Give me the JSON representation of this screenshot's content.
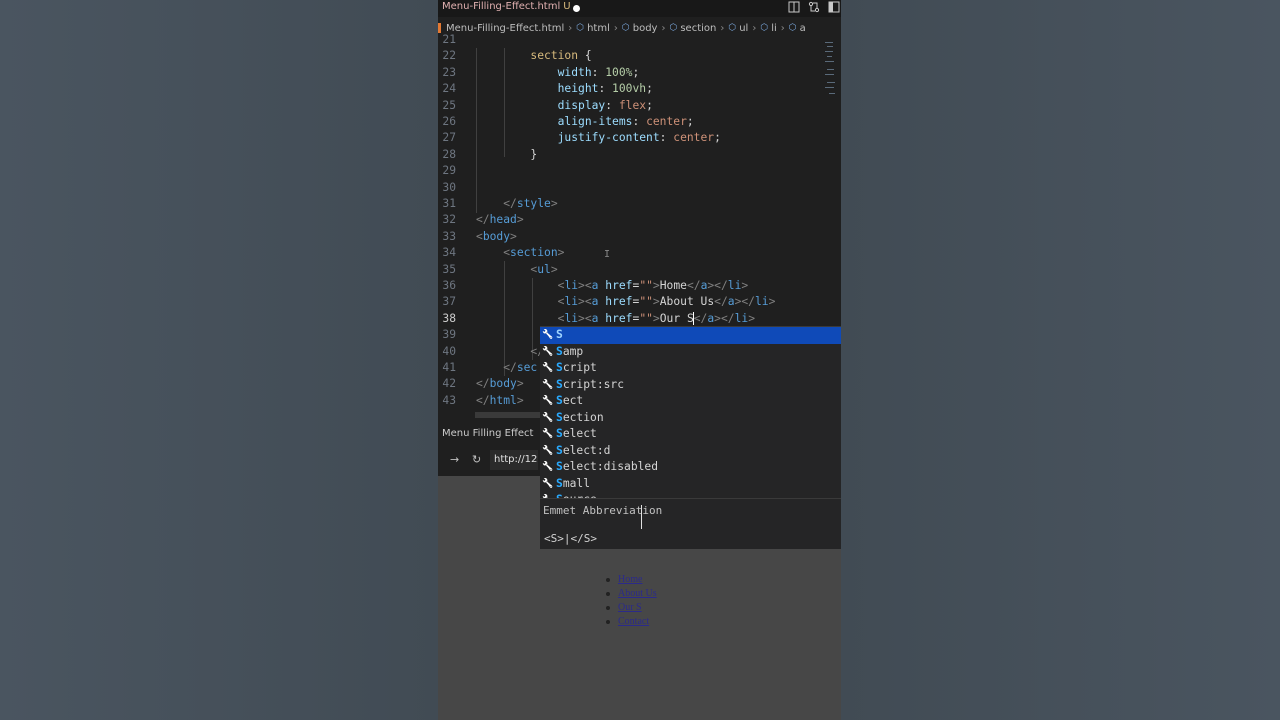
{
  "titlebar": {
    "file_tab": "Menu-Filling-Effect.html",
    "modified_flag": "U",
    "icons": [
      "split-editor-icon",
      "compare-icon",
      "layout-icon"
    ]
  },
  "breadcrumb": {
    "items": [
      "Menu-Filling-Effect.html",
      "html",
      "body",
      "section",
      "ul",
      "li",
      "a"
    ]
  },
  "editor": {
    "active_line": "38",
    "lines": [
      {
        "n": "21",
        "html": ""
      },
      {
        "n": "22",
        "html": "        <span class='sel'>section</span> {"
      },
      {
        "n": "23",
        "html": "            <span class='prop'>width</span>: <span class='num'>100%</span>;"
      },
      {
        "n": "24",
        "html": "            <span class='prop'>height</span>: <span class='num'>100vh</span>;"
      },
      {
        "n": "25",
        "html": "            <span class='prop'>display</span>: <span class='val'>flex</span>;"
      },
      {
        "n": "26",
        "html": "            <span class='prop'>align-items</span>: <span class='val'>center</span>;"
      },
      {
        "n": "27",
        "html": "            <span class='prop'>justify-content</span>: <span class='val'>center</span>;"
      },
      {
        "n": "28",
        "html": "        }"
      },
      {
        "n": "29",
        "html": ""
      },
      {
        "n": "30",
        "html": ""
      },
      {
        "n": "31",
        "html": "    <span class='br'>&lt;/</span><span class='tag'>style</span><span class='br'>&gt;</span>"
      },
      {
        "n": "32",
        "html": "<span class='br'>&lt;/</span><span class='tag'>head</span><span class='br'>&gt;</span>"
      },
      {
        "n": "33",
        "html": "<span class='br'>&lt;</span><span class='tag'>body</span><span class='br'>&gt;</span>"
      },
      {
        "n": "34",
        "html": "    <span class='br'>&lt;</span><span class='tag'>section</span><span class='br'>&gt;</span>"
      },
      {
        "n": "35",
        "html": "        <span class='br'>&lt;</span><span class='tag'>ul</span><span class='br'>&gt;</span>"
      },
      {
        "n": "36",
        "html": "            <span class='br'>&lt;</span><span class='tag'>li</span><span class='br'>&gt;&lt;</span><span class='tag'>a</span> <span class='attr'>href</span>=<span class='str'>\"\"</span><span class='br'>&gt;</span>Home<span class='br'>&lt;/</span><span class='tag'>a</span><span class='br'>&gt;&lt;/</span><span class='tag'>li</span><span class='br'>&gt;</span>"
      },
      {
        "n": "37",
        "html": "            <span class='br'>&lt;</span><span class='tag'>li</span><span class='br'>&gt;&lt;</span><span class='tag'>a</span> <span class='attr'>href</span>=<span class='str'>\"\"</span><span class='br'>&gt;</span>About Us<span class='br'>&lt;/</span><span class='tag'>a</span><span class='br'>&gt;&lt;/</span><span class='tag'>li</span><span class='br'>&gt;</span>"
      },
      {
        "n": "38",
        "html": "            <span class='br'>&lt;</span><span class='tag'>li</span><span class='br'>&gt;&lt;</span><span class='tag'>a</span> <span class='attr'>href</span>=<span class='str'>\"\"</span><span class='br'>&gt;</span>Our S<span style='border-left:1px solid #fff;margin-left:-1px'></span><span class='br'>&lt;/</span><span class='tag'>a</span><span class='br'>&gt;&lt;/</span><span class='tag'>li</span><span class='br'>&gt;</span>"
      },
      {
        "n": "39",
        "html": ""
      },
      {
        "n": "40",
        "html": "        <span class='br'>&lt;/</span>"
      },
      {
        "n": "41",
        "html": "    <span class='br'>&lt;/</span><span class='tag'>sec</span>"
      },
      {
        "n": "42",
        "html": "<span class='br'>&lt;/</span><span class='tag'>body</span><span class='br'>&gt;</span>"
      },
      {
        "n": "43",
        "html": "<span class='br'>&lt;/</span><span class='tag'>html</span><span class='br'>&gt;</span>"
      }
    ]
  },
  "browser": {
    "tab_title": "Menu Filling Effect",
    "url": "http://12",
    "back_icon": "arrow-right-icon",
    "reload_icon": "reload-icon",
    "preview_links": [
      "Home",
      "About Us",
      "Our S",
      "Contact"
    ]
  },
  "suggest": {
    "typed": "S",
    "items": [
      {
        "hl": "S",
        "rest": ""
      },
      {
        "hl": "S",
        "rest": "amp"
      },
      {
        "hl": "S",
        "rest": "cript"
      },
      {
        "hl": "S",
        "rest": "cript:src"
      },
      {
        "hl": "S",
        "rest": "ect"
      },
      {
        "hl": "S",
        "rest": "ection"
      },
      {
        "hl": "S",
        "rest": "elect"
      },
      {
        "hl": "S",
        "rest": "elect:d"
      },
      {
        "hl": "S",
        "rest": "elect:disabled"
      },
      {
        "hl": "S",
        "rest": "mall"
      },
      {
        "hl": "S",
        "rest": "ource"
      }
    ],
    "detail_title": "Emmet Abbreviation",
    "detail_code": "<S>|</S>"
  }
}
